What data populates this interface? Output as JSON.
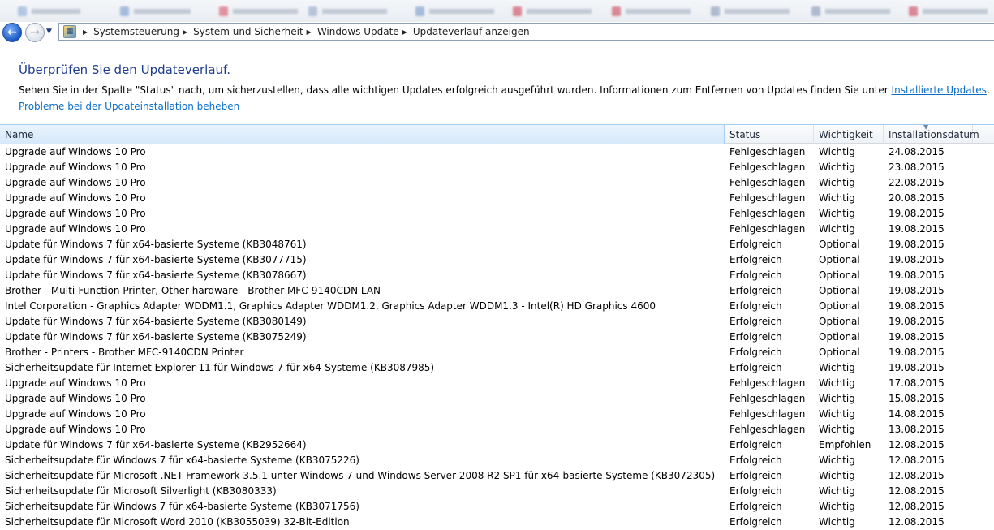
{
  "breadcrumb": [
    "Systemsteuerung",
    "System und Sicherheit",
    "Windows Update",
    "Updateverlauf anzeigen"
  ],
  "page": {
    "title": "Überprüfen Sie den Updateverlauf.",
    "desc_prefix": "Sehen Sie in der Spalte \"Status\" nach, um sicherzustellen, dass alle wichtigen Updates erfolgreich ausgeführt wurden. Informationen zum Entfernen von Updates finden Sie unter ",
    "desc_link": "Installierte Updates",
    "desc_suffix": ".",
    "fix_link": "Probleme bei der Updateinstallation beheben"
  },
  "columns": {
    "name": "Name",
    "status": "Status",
    "importance": "Wichtigkeit",
    "date": "Installationsdatum"
  },
  "rows": [
    {
      "name": "Upgrade auf Windows 10 Pro",
      "status": "Fehlgeschlagen",
      "importance": "Wichtig",
      "date": "24.08.2015"
    },
    {
      "name": "Upgrade auf Windows 10 Pro",
      "status": "Fehlgeschlagen",
      "importance": "Wichtig",
      "date": "23.08.2015"
    },
    {
      "name": "Upgrade auf Windows 10 Pro",
      "status": "Fehlgeschlagen",
      "importance": "Wichtig",
      "date": "22.08.2015"
    },
    {
      "name": "Upgrade auf Windows 10 Pro",
      "status": "Fehlgeschlagen",
      "importance": "Wichtig",
      "date": "20.08.2015"
    },
    {
      "name": "Upgrade auf Windows 10 Pro",
      "status": "Fehlgeschlagen",
      "importance": "Wichtig",
      "date": "19.08.2015"
    },
    {
      "name": "Upgrade auf Windows 10 Pro",
      "status": "Fehlgeschlagen",
      "importance": "Wichtig",
      "date": "19.08.2015"
    },
    {
      "name": "Update für Windows 7 für x64-basierte Systeme (KB3048761)",
      "status": "Erfolgreich",
      "importance": "Optional",
      "date": "19.08.2015"
    },
    {
      "name": "Update für Windows 7 für x64-basierte Systeme (KB3077715)",
      "status": "Erfolgreich",
      "importance": "Optional",
      "date": "19.08.2015"
    },
    {
      "name": "Update für Windows 7 für x64-basierte Systeme (KB3078667)",
      "status": "Erfolgreich",
      "importance": "Optional",
      "date": "19.08.2015"
    },
    {
      "name": "Brother - Multi-Function Printer, Other hardware - Brother MFC-9140CDN LAN",
      "status": "Erfolgreich",
      "importance": "Optional",
      "date": "19.08.2015"
    },
    {
      "name": "Intel Corporation - Graphics Adapter WDDM1.1, Graphics Adapter WDDM1.2, Graphics Adapter WDDM1.3 - Intel(R) HD Graphics 4600",
      "status": "Erfolgreich",
      "importance": "Optional",
      "date": "19.08.2015"
    },
    {
      "name": "Update für Windows 7 für x64-basierte Systeme (KB3080149)",
      "status": "Erfolgreich",
      "importance": "Optional",
      "date": "19.08.2015"
    },
    {
      "name": "Update für Windows 7 für x64-basierte Systeme (KB3075249)",
      "status": "Erfolgreich",
      "importance": "Optional",
      "date": "19.08.2015"
    },
    {
      "name": "Brother - Printers - Brother MFC-9140CDN Printer",
      "status": "Erfolgreich",
      "importance": "Optional",
      "date": "19.08.2015"
    },
    {
      "name": "Sicherheitsupdate für Internet Explorer 11 für Windows 7 für x64-Systeme (KB3087985)",
      "status": "Erfolgreich",
      "importance": "Wichtig",
      "date": "19.08.2015"
    },
    {
      "name": "Upgrade auf Windows 10 Pro",
      "status": "Fehlgeschlagen",
      "importance": "Wichtig",
      "date": "17.08.2015"
    },
    {
      "name": "Upgrade auf Windows 10 Pro",
      "status": "Fehlgeschlagen",
      "importance": "Wichtig",
      "date": "15.08.2015"
    },
    {
      "name": "Upgrade auf Windows 10 Pro",
      "status": "Fehlgeschlagen",
      "importance": "Wichtig",
      "date": "14.08.2015"
    },
    {
      "name": "Upgrade auf Windows 10 Pro",
      "status": "Fehlgeschlagen",
      "importance": "Wichtig",
      "date": "13.08.2015"
    },
    {
      "name": "Update für Windows 7 für x64-basierte Systeme (KB2952664)",
      "status": "Erfolgreich",
      "importance": "Empfohlen",
      "date": "12.08.2015"
    },
    {
      "name": "Sicherheitsupdate für Windows 7 für x64-basierte Systeme (KB3075226)",
      "status": "Erfolgreich",
      "importance": "Wichtig",
      "date": "12.08.2015"
    },
    {
      "name": "Sicherheitsupdate für Microsoft .NET Framework 3.5.1 unter Windows 7 und Windows Server 2008 R2 SP1 für x64-basierte Systeme (KB3072305)",
      "status": "Erfolgreich",
      "importance": "Wichtig",
      "date": "12.08.2015"
    },
    {
      "name": "Sicherheitsupdate für Microsoft Silverlight (KB3080333)",
      "status": "Erfolgreich",
      "importance": "Wichtig",
      "date": "12.08.2015"
    },
    {
      "name": "Sicherheitsupdate für Windows 7 für x64-basierte Systeme (KB3071756)",
      "status": "Erfolgreich",
      "importance": "Wichtig",
      "date": "12.08.2015"
    },
    {
      "name": "Sicherheitsupdate für Microsoft Word 2010 (KB3055039) 32-Bit-Edition",
      "status": "Erfolgreich",
      "importance": "Wichtig",
      "date": "12.08.2015"
    }
  ],
  "colors": {
    "title": "#1e3d8f",
    "link": "#0a6ec8",
    "header_selected": "#d6e9fb"
  }
}
